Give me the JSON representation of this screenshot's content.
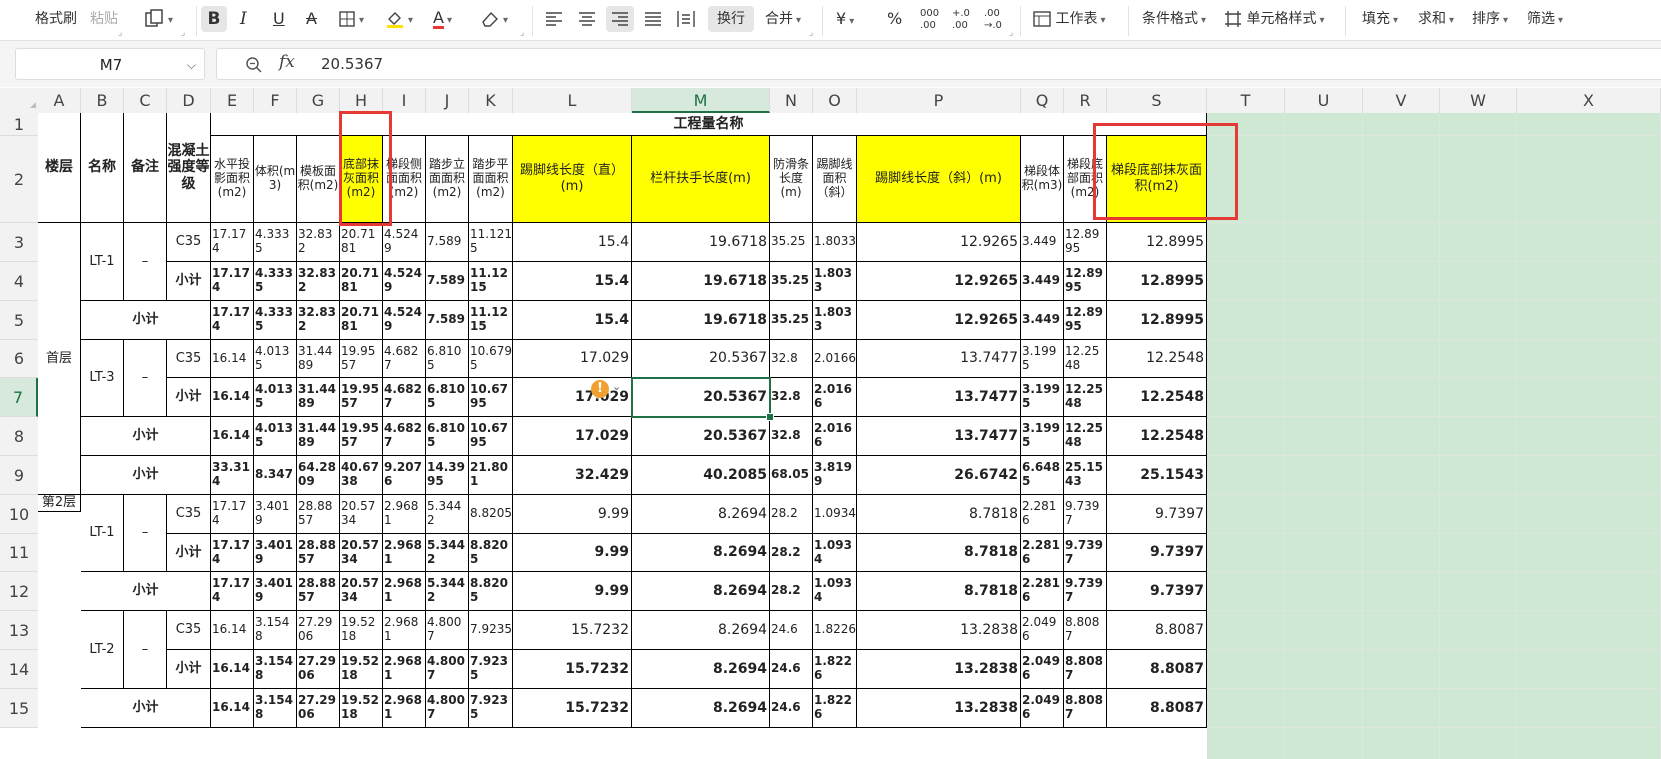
{
  "ribbon": {
    "format_painter": "格式刷",
    "paste": "粘贴",
    "wrap": "换行",
    "merge": "合并",
    "worksheet": "工作表",
    "cond_format": "条件格式",
    "cell_style": "单元格样式",
    "fill": "填充",
    "sum": "求和",
    "sort": "排序",
    "filter": "筛选",
    "currency_symbol": "¥",
    "percent_symbol": "%"
  },
  "formula_bar": {
    "cell_ref": "M7",
    "fx": "fx",
    "value": "20.5367"
  },
  "columns": [
    "A",
    "B",
    "C",
    "D",
    "E",
    "F",
    "G",
    "H",
    "I",
    "J",
    "K",
    "L",
    "M",
    "N",
    "O",
    "P",
    "Q",
    "R",
    "S",
    "T",
    "U",
    "V",
    "W",
    "X"
  ],
  "rows": [
    "1",
    "2",
    "3",
    "4",
    "5",
    "6",
    "7",
    "8",
    "9",
    "10",
    "11",
    "12",
    "13",
    "14",
    "15"
  ],
  "header": {
    "title": "工程量名称",
    "floor": "楼层",
    "name": "名称",
    "note": "备注",
    "grade": "混凝土强度等级",
    "E": "水平投影面积(m2)",
    "F": "体积(m3)",
    "G": "模板面积(m2)",
    "H": "底部抹灰面积(m2)",
    "I": "梯段侧面面积(m2)",
    "J": "踏步立面面积(m2)",
    "K": "踏步平面面积(m2)",
    "L": "踢脚线长度（直）(m)",
    "M": "栏杆扶手长度(m)",
    "N": "防滑条长度(m)",
    "O": "踢脚线面积（斜）",
    "P": "踢脚线长度（斜）(m)",
    "Q": "梯段体积(m3)",
    "R": "梯段底部面积(m2)",
    "S": "梯段底部抹灰面积(m2)"
  },
  "labels": {
    "floor1": "首层",
    "floor2": "第2层",
    "lt1": "LT-1",
    "lt3": "LT-3",
    "lt2": "LT-2",
    "dash": "–",
    "c35": "C35",
    "subtotal": "小计"
  },
  "data": {
    "r3": {
      "E": "17.174",
      "F": "4.3335",
      "G": "32.832",
      "H": "20.7181",
      "I": "4.5249",
      "J": "7.589",
      "K": "11.1215",
      "L": "15.4",
      "M": "19.6718",
      "N": "35.25",
      "O": "1.8033",
      "P": "12.9265",
      "Q": "3.449",
      "R": "12.8995",
      "S": "12.8995"
    },
    "r4": {
      "E": "17.174",
      "F": "4.3335",
      "G": "32.832",
      "H": "20.7181",
      "I": "4.5249",
      "J": "7.589",
      "K": "11.1215",
      "L": "15.4",
      "M": "19.6718",
      "N": "35.25",
      "O": "1.8033",
      "P": "12.9265",
      "Q": "3.449",
      "R": "12.8995",
      "S": "12.8995"
    },
    "r5": {
      "E": "17.174",
      "F": "4.3335",
      "G": "32.832",
      "H": "20.7181",
      "I": "4.5249",
      "J": "7.589",
      "K": "11.1215",
      "L": "15.4",
      "M": "19.6718",
      "N": "35.25",
      "O": "1.8033",
      "P": "12.9265",
      "Q": "3.449",
      "R": "12.8995",
      "S": "12.8995"
    },
    "r6": {
      "E": "16.14",
      "F": "4.0135",
      "G": "31.4489",
      "H": "19.9557",
      "I": "4.6827",
      "J": "6.8105",
      "K": "10.6795",
      "L": "17.029",
      "M": "20.5367",
      "N": "32.8",
      "O": "2.0166",
      "P": "13.7477",
      "Q": "3.1995",
      "R": "12.2548",
      "S": "12.2548"
    },
    "r7": {
      "E": "16.14",
      "F": "4.0135",
      "G": "31.4489",
      "H": "19.9557",
      "I": "4.6827",
      "J": "6.8105",
      "K": "10.6795",
      "L": "17.029",
      "M": "20.5367",
      "N": "32.8",
      "O": "2.0166",
      "P": "13.7477",
      "Q": "3.1995",
      "R": "12.2548",
      "S": "12.2548"
    },
    "r8": {
      "E": "16.14",
      "F": "4.0135",
      "G": "31.4489",
      "H": "19.9557",
      "I": "4.6827",
      "J": "6.8105",
      "K": "10.6795",
      "L": "17.029",
      "M": "20.5367",
      "N": "32.8",
      "O": "2.0166",
      "P": "13.7477",
      "Q": "3.1995",
      "R": "12.2548",
      "S": "12.2548"
    },
    "r9": {
      "E": "33.314",
      "F": "8.347",
      "G": "64.2809",
      "H": "40.6738",
      "I": "9.2076",
      "J": "14.3995",
      "K": "21.801",
      "L": "32.429",
      "M": "40.2085",
      "N": "68.05",
      "O": "3.8199",
      "P": "26.6742",
      "Q": "6.6485",
      "R": "25.1543",
      "S": "25.1543"
    },
    "r10": {
      "E": "17.174",
      "F": "3.4019",
      "G": "28.8857",
      "H": "20.5734",
      "I": "2.9681",
      "J": "5.3442",
      "K": "8.8205",
      "L": "9.99",
      "M": "8.2694",
      "N": "28.2",
      "O": "1.0934",
      "P": "8.7818",
      "Q": "2.2816",
      "R": "9.7397",
      "S": "9.7397"
    },
    "r11": {
      "E": "17.174",
      "F": "3.4019",
      "G": "28.8857",
      "H": "20.5734",
      "I": "2.9681",
      "J": "5.3442",
      "K": "8.8205",
      "L": "9.99",
      "M": "8.2694",
      "N": "28.2",
      "O": "1.0934",
      "P": "8.7818",
      "Q": "2.2816",
      "R": "9.7397",
      "S": "9.7397"
    },
    "r12": {
      "E": "17.174",
      "F": "3.4019",
      "G": "28.8857",
      "H": "20.5734",
      "I": "2.9681",
      "J": "5.3442",
      "K": "8.8205",
      "L": "9.99",
      "M": "8.2694",
      "N": "28.2",
      "O": "1.0934",
      "P": "8.7818",
      "Q": "2.2816",
      "R": "9.7397",
      "S": "9.7397"
    },
    "r13": {
      "E": "16.14",
      "F": "3.1548",
      "G": "27.2906",
      "H": "19.5218",
      "I": "2.9681",
      "J": "4.8007",
      "K": "7.9235",
      "L": "15.7232",
      "M": "8.2694",
      "N": "24.6",
      "O": "1.8226",
      "P": "13.2838",
      "Q": "2.0496",
      "R": "8.8087",
      "S": "8.8087"
    },
    "r14": {
      "E": "16.14",
      "F": "3.1548",
      "G": "27.2906",
      "H": "19.5218",
      "I": "2.9681",
      "J": "4.8007",
      "K": "7.9235",
      "L": "15.7232",
      "M": "8.2694",
      "N": "24.6",
      "O": "1.8226",
      "P": "13.2838",
      "Q": "2.0496",
      "R": "8.8087",
      "S": "8.8087"
    },
    "r15": {
      "E": "16.14",
      "F": "3.1548",
      "G": "27.2906",
      "H": "19.5218",
      "I": "2.9681",
      "J": "4.8007",
      "K": "7.9235",
      "L": "15.7232",
      "M": "8.2694",
      "N": "24.6",
      "O": "1.8226",
      "P": "13.2838",
      "Q": "2.0496",
      "R": "8.8087",
      "S": "8.8087"
    }
  },
  "colors": {
    "accent": "#1e7145",
    "highlight": "#ffff00",
    "annotation": "#e53935",
    "empty_area": "#cfe8d4"
  }
}
